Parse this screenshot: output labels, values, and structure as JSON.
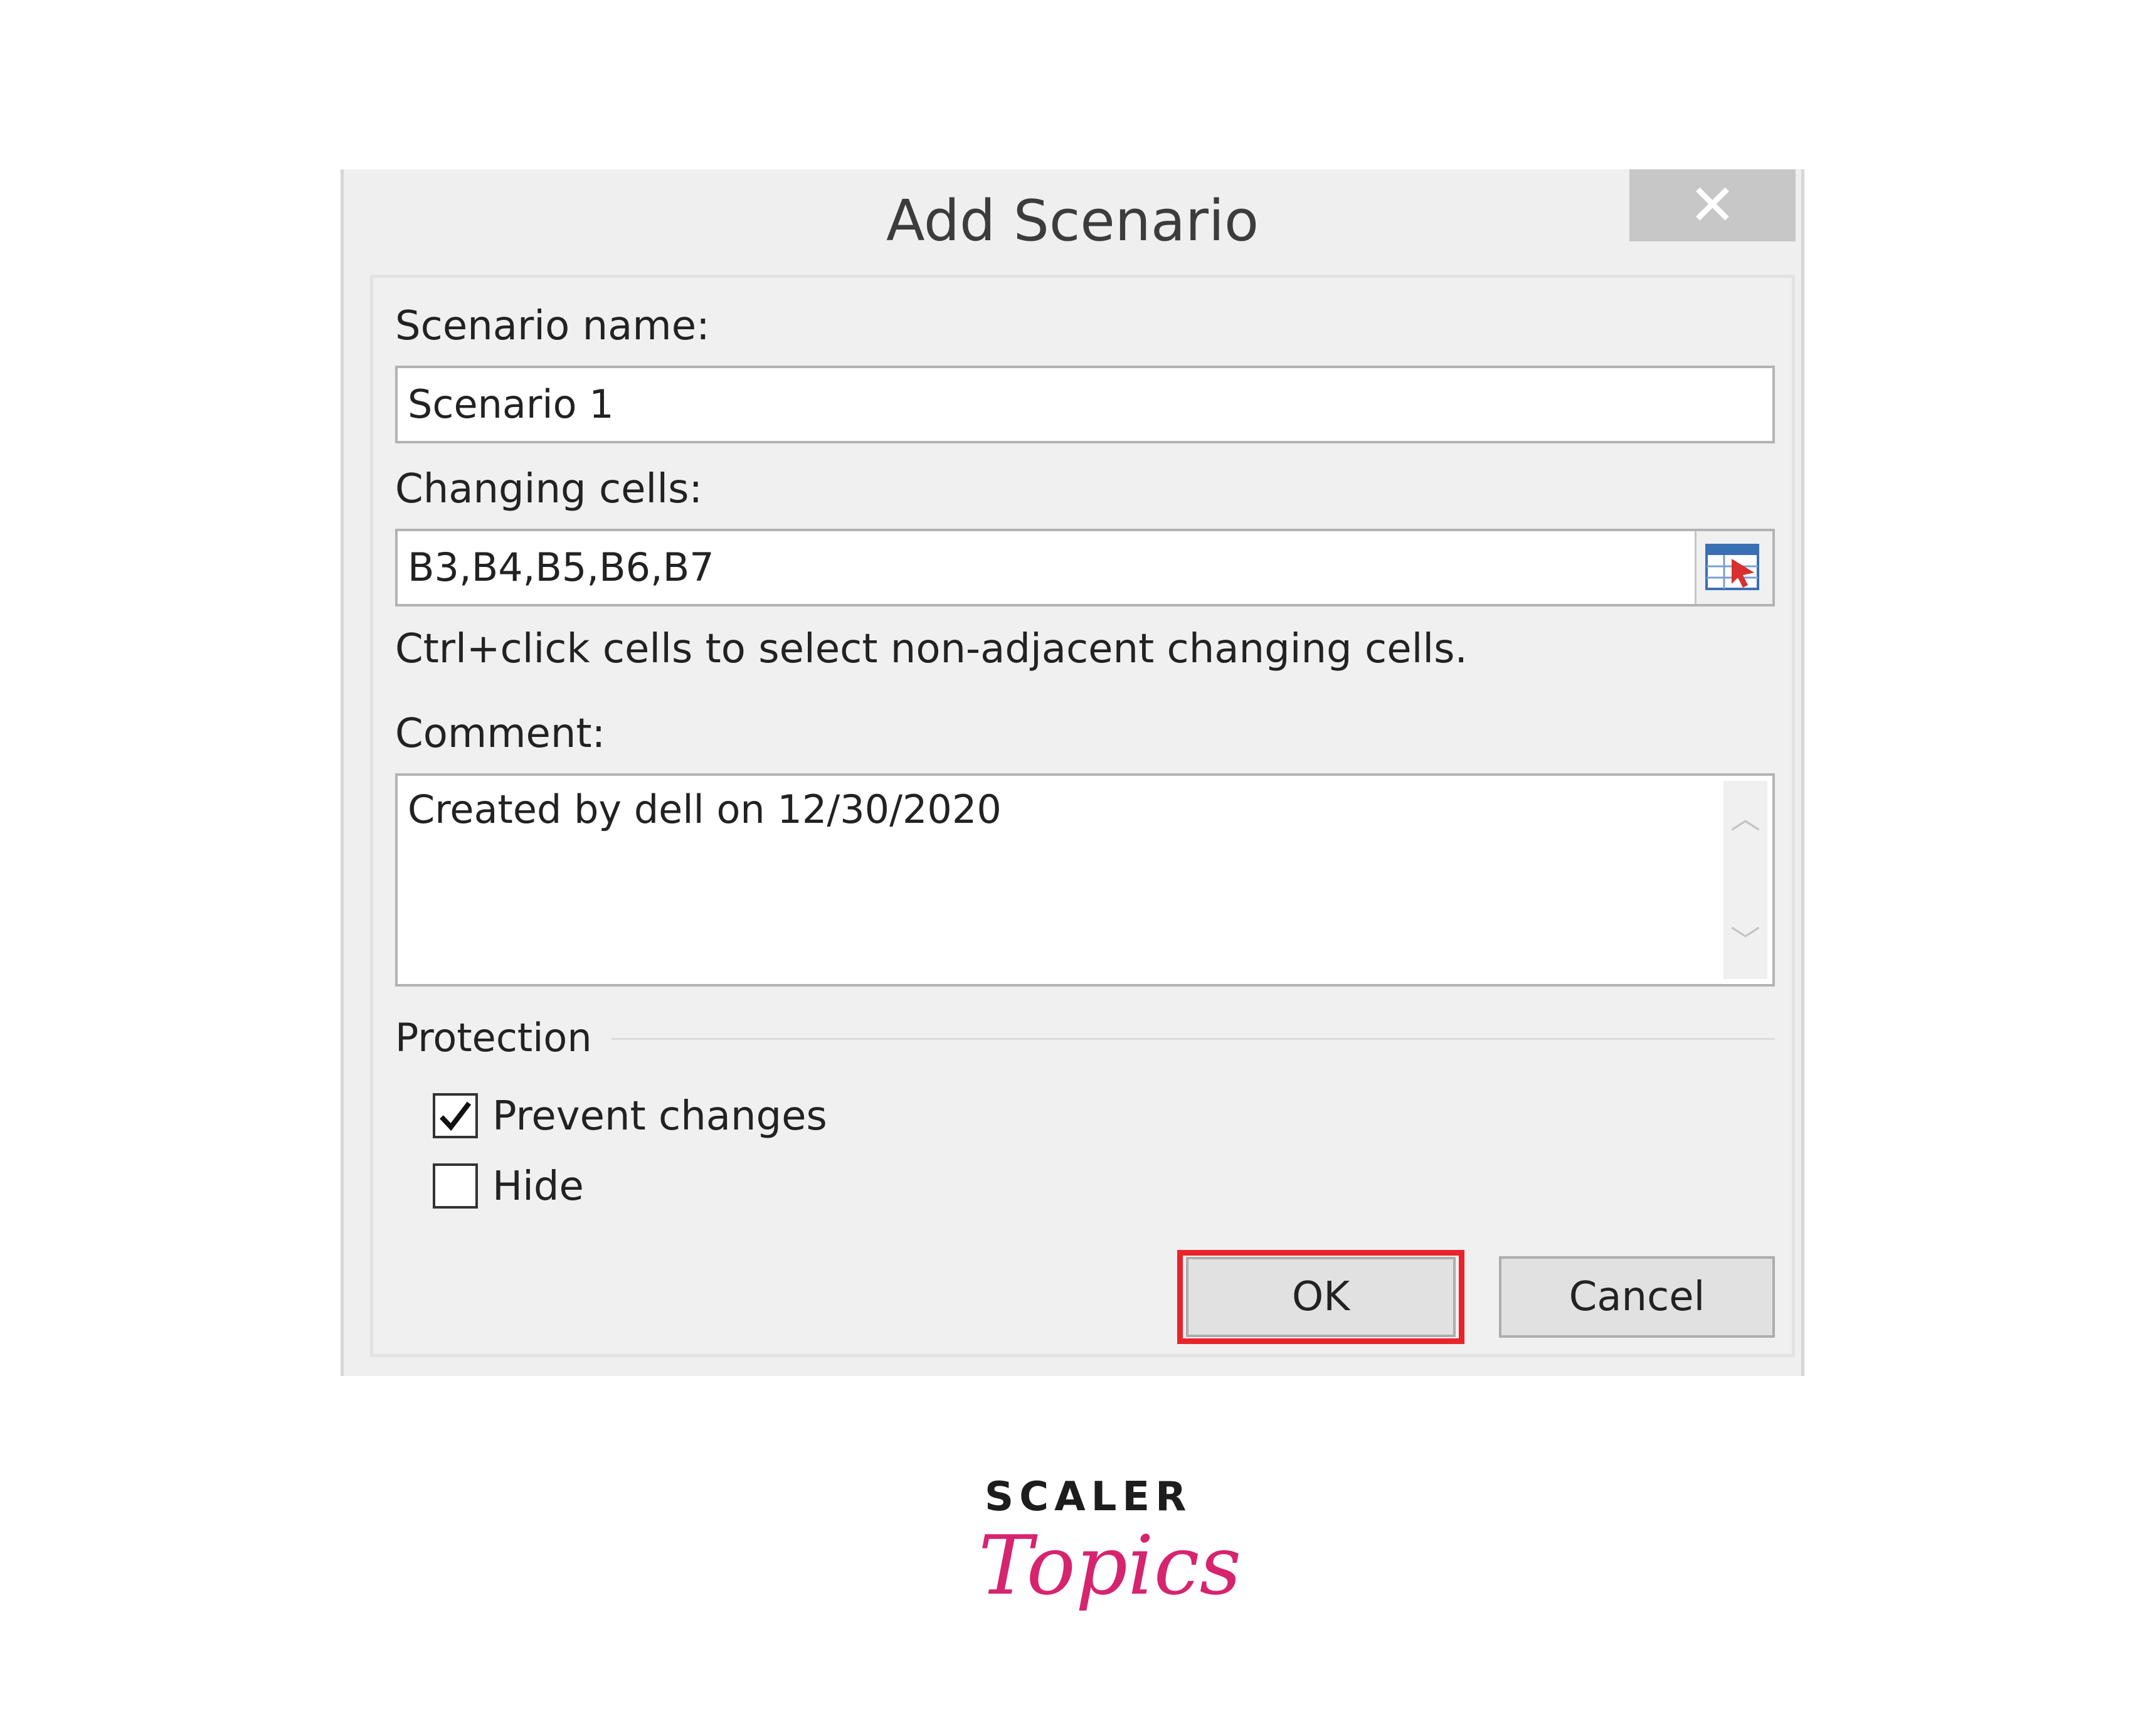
{
  "dialog": {
    "title": "Add Scenario",
    "help": "?",
    "close": "✕"
  },
  "form": {
    "scenario_name_label": "Scenario name:",
    "scenario_name_value": "Scenario 1",
    "changing_cells_label": "Changing cells:",
    "changing_cells_value": "B3,B4,B5,B6,B7",
    "hint": "Ctrl+click cells to select non-adjacent changing cells.",
    "comment_label": "Comment:",
    "comment_value": "Created by dell on 12/30/2020",
    "protection_label": "Protection",
    "prevent_changes_label": "Prevent changes",
    "prevent_changes_checked": true,
    "hide_label": "Hide",
    "hide_checked": false
  },
  "buttons": {
    "ok": "OK",
    "cancel": "Cancel"
  },
  "brand": {
    "line1": "SCALER",
    "line2": "Topics",
    "accent": "#d6246e"
  }
}
